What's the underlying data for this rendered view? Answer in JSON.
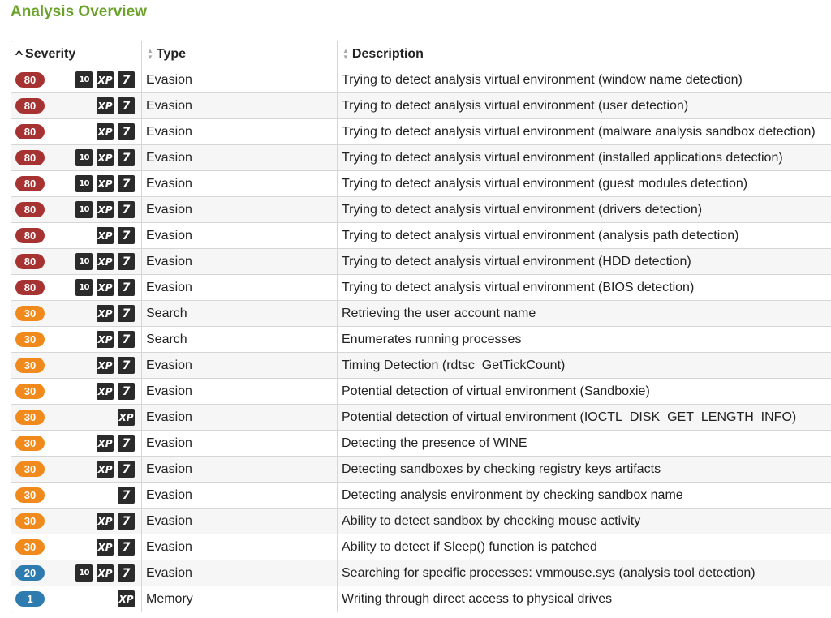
{
  "page": {
    "title": "Analysis Overview"
  },
  "table": {
    "headers": {
      "severity": "Severity",
      "type": "Type",
      "description": "Description"
    },
    "rows": [
      {
        "score": "80",
        "level": "high",
        "os": [
          "10",
          "XP",
          "7"
        ],
        "type": "Evasion",
        "description": "Trying to detect analysis virtual environment (window name detection)"
      },
      {
        "score": "80",
        "level": "high",
        "os": [
          "XP",
          "7"
        ],
        "type": "Evasion",
        "description": "Trying to detect analysis virtual environment (user detection)"
      },
      {
        "score": "80",
        "level": "high",
        "os": [
          "XP",
          "7"
        ],
        "type": "Evasion",
        "description": "Trying to detect analysis virtual environment (malware analysis sandbox detection)"
      },
      {
        "score": "80",
        "level": "high",
        "os": [
          "10",
          "XP",
          "7"
        ],
        "type": "Evasion",
        "description": "Trying to detect analysis virtual environment (installed applications detection)"
      },
      {
        "score": "80",
        "level": "high",
        "os": [
          "10",
          "XP",
          "7"
        ],
        "type": "Evasion",
        "description": "Trying to detect analysis virtual environment (guest modules detection)"
      },
      {
        "score": "80",
        "level": "high",
        "os": [
          "10",
          "XP",
          "7"
        ],
        "type": "Evasion",
        "description": "Trying to detect analysis virtual environment (drivers detection)"
      },
      {
        "score": "80",
        "level": "high",
        "os": [
          "XP",
          "7"
        ],
        "type": "Evasion",
        "description": "Trying to detect analysis virtual environment (analysis path detection)"
      },
      {
        "score": "80",
        "level": "high",
        "os": [
          "10",
          "XP",
          "7"
        ],
        "type": "Evasion",
        "description": "Trying to detect analysis virtual environment (HDD detection)"
      },
      {
        "score": "80",
        "level": "high",
        "os": [
          "10",
          "XP",
          "7"
        ],
        "type": "Evasion",
        "description": "Trying to detect analysis virtual environment (BIOS detection)"
      },
      {
        "score": "30",
        "level": "mid",
        "os": [
          "XP",
          "7"
        ],
        "type": "Search",
        "description": "Retrieving the user account name"
      },
      {
        "score": "30",
        "level": "mid",
        "os": [
          "XP",
          "7"
        ],
        "type": "Search",
        "description": "Enumerates running processes"
      },
      {
        "score": "30",
        "level": "mid",
        "os": [
          "XP",
          "7"
        ],
        "type": "Evasion",
        "description": "Timing Detection (rdtsc_GetTickCount)"
      },
      {
        "score": "30",
        "level": "mid",
        "os": [
          "XP",
          "7"
        ],
        "type": "Evasion",
        "description": "Potential detection of virtual environment (Sandboxie)"
      },
      {
        "score": "30",
        "level": "mid",
        "os": [
          "XP"
        ],
        "type": "Evasion",
        "description": "Potential detection of virtual environment (IOCTL_DISK_GET_LENGTH_INFO)"
      },
      {
        "score": "30",
        "level": "mid",
        "os": [
          "XP",
          "7"
        ],
        "type": "Evasion",
        "description": "Detecting the presence of WINE"
      },
      {
        "score": "30",
        "level": "mid",
        "os": [
          "XP",
          "7"
        ],
        "type": "Evasion",
        "description": "Detecting sandboxes by checking registry keys artifacts"
      },
      {
        "score": "30",
        "level": "mid",
        "os": [
          "7"
        ],
        "type": "Evasion",
        "description": "Detecting analysis environment by checking sandbox name"
      },
      {
        "score": "30",
        "level": "mid",
        "os": [
          "XP",
          "7"
        ],
        "type": "Evasion",
        "description": "Ability to detect sandbox by checking mouse activity"
      },
      {
        "score": "30",
        "level": "mid",
        "os": [
          "XP",
          "7"
        ],
        "type": "Evasion",
        "description": "Ability to detect if Sleep() function is patched"
      },
      {
        "score": "20",
        "level": "low",
        "os": [
          "10",
          "XP",
          "7"
        ],
        "type": "Evasion",
        "description": "Searching for specific processes: vmmouse.sys (analysis tool detection)"
      },
      {
        "score": "1",
        "level": "low",
        "os": [
          "XP"
        ],
        "type": "Memory",
        "description": "Writing through direct access to physical drives"
      }
    ]
  },
  "colors": {
    "title": "#6aa22a",
    "high": "#a73232",
    "mid": "#f08a1c",
    "low": "#2e7bb0"
  },
  "icons": {
    "sort_active": "chevron-up-icon",
    "sort_inactive": "sort-icon",
    "os": [
      "windows-10-icon",
      "windows-xp-icon",
      "windows-7-icon"
    ]
  }
}
